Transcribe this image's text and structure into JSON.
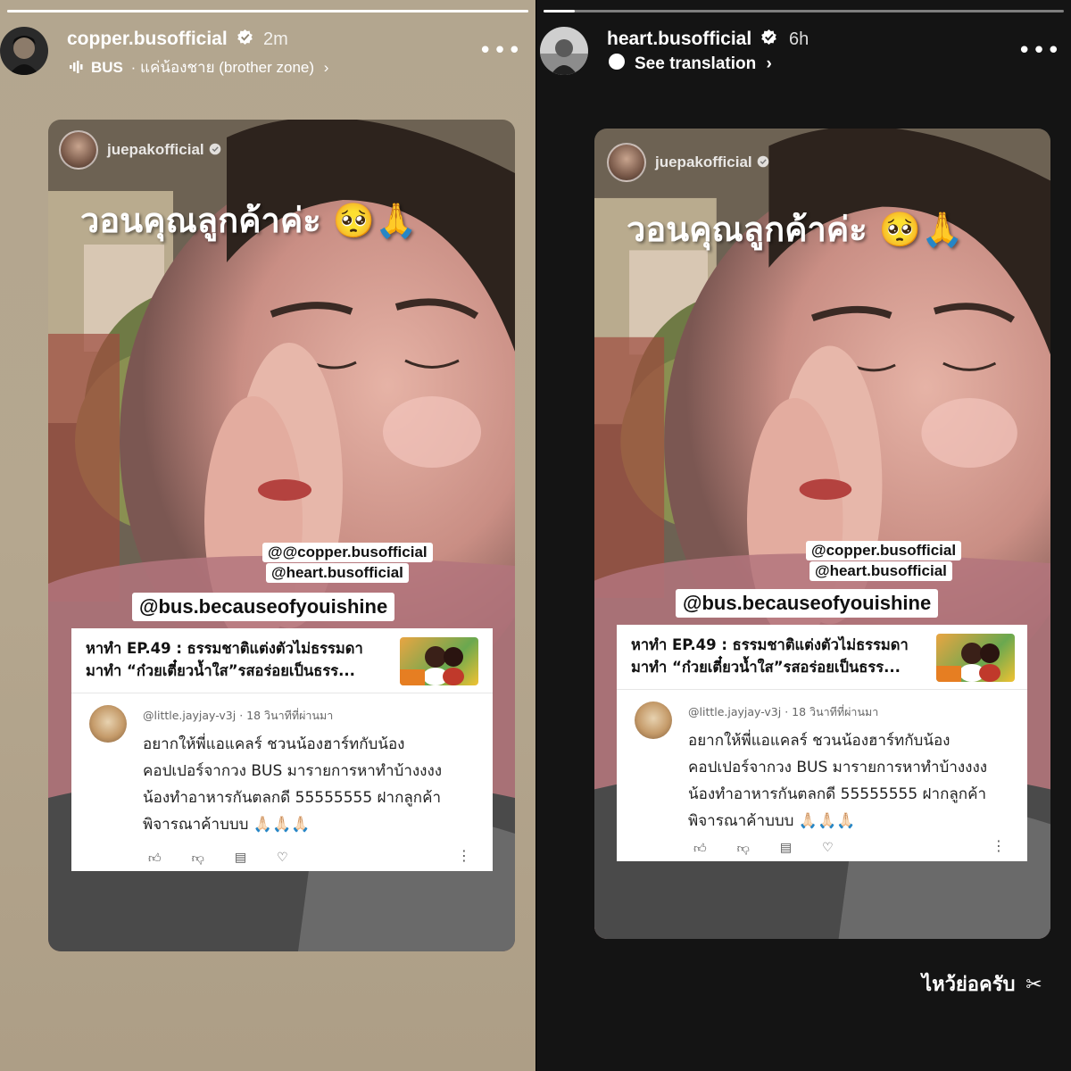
{
  "left_story": {
    "username": "copper.busofficial",
    "time": "2m",
    "music_artist": "BUS",
    "music_song": "· แค่น้องชาย (brother zone)",
    "more_label": "•••",
    "progress_value": 1.0
  },
  "right_story": {
    "username": "heart.busofficial",
    "time": "6h",
    "translation_label": "See translation",
    "more_label": "•••",
    "progress_value": 0.06,
    "footer_caption": "ไหว้ย่อครับ"
  },
  "reshared_story": {
    "author": "juepakofficial",
    "caption": "วอนคุณลูกค้าค่ะ 🥺🙏",
    "mention_1": "@copper.busofficial",
    "mention_2": "@heart.busofficial",
    "mention_3": "@bus.becauseofyouishine"
  },
  "youtube_comment": {
    "video_title_line1": "หาทำ EP.49 : ธรรมชาติแต่งตัวไม่ธรรมดา",
    "video_title_line2": "มาทำ “ก๋วยเตี๋ยวน้ำใส”รสอร่อยเป็นธรร...",
    "commenter": "@little.jayjay-v3j",
    "comment_time": "· 18 วินาทีที่ผ่านมา",
    "comment_line1": "อยากให้พี่แอแคลร์ ชวนน้องฮาร์ทกับน้อง",
    "comment_line2": "คอปเปอร์จากวง BUS มารายการหาทำบ้างงงง",
    "comment_line3": "น้องทำอาหารกันตลกดี 55555555 ฝากลูกค้า",
    "comment_line4": "พิจารณาค้าบบบ 🙏🏻🙏🏻🙏🏻",
    "more_label": "⋮"
  },
  "colors": {
    "left_bg": "#b3a68f",
    "right_bg": "#141414",
    "verified": "#ffffff"
  },
  "icons": [
    "verified-icon",
    "music-bars-icon",
    "chevron-right-icon",
    "translate-bubble-icon",
    "like-icon",
    "dislike-icon",
    "reply-icon",
    "heart-icon",
    "scissors-icon",
    "threads-icon"
  ]
}
